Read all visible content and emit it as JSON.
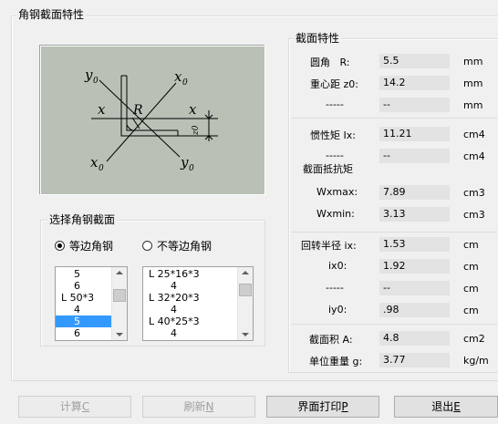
{
  "main_group": {
    "title": "角钢截面特性"
  },
  "diagram": {
    "labels": {
      "y0_top": "y",
      "x0_top": "x",
      "x_left": "x",
      "x_right": "x",
      "r": "R",
      "z0": "z0",
      "x0_bottom": "x",
      "y0_bottom": "y",
      "sub": "0"
    }
  },
  "select_group": {
    "title": "选择角钢截面",
    "equal_label": "等边角钢",
    "unequal_label": "不等边角钢",
    "equal_checked": true,
    "equal_list": [
      "5",
      "6",
      "L 50*3",
      "4",
      "5",
      "6"
    ],
    "equal_selected_index": 4,
    "unequal_list": [
      "L 25*16*3",
      "4",
      "L 32*20*3",
      "4",
      "L 40*25*3",
      "4"
    ]
  },
  "props": {
    "title": "截面特性",
    "resist_title": "截面抵抗矩",
    "rows": [
      {
        "label": "圆角   R:",
        "value": "5.5",
        "unit": "mm"
      },
      {
        "label": "重心距 z0:",
        "value": "14.2",
        "unit": "mm"
      },
      {
        "label": "-----",
        "value": "--",
        "unit": "mm"
      },
      {
        "label": "惯性矩 Ix:",
        "value": "11.21",
        "unit": "cm4"
      },
      {
        "label": "-----",
        "value": "--",
        "unit": "cm4"
      },
      {
        "label": "Wxmax:",
        "value": "7.89",
        "unit": "cm3"
      },
      {
        "label": "Wxmin:",
        "value": "3.13",
        "unit": "cm3"
      },
      {
        "label": "回转半径 ix:",
        "value": "1.53",
        "unit": "cm"
      },
      {
        "label": "ix0:",
        "value": "1.92",
        "unit": "cm"
      },
      {
        "label": "-----",
        "value": "--",
        "unit": "cm"
      },
      {
        "label": "iy0:",
        "value": ".98",
        "unit": "cm"
      },
      {
        "label": "截面积 A:",
        "value": "4.8",
        "unit": "cm2"
      },
      {
        "label": "单位重量 g:",
        "value": "3.77",
        "unit": "kg/m"
      }
    ]
  },
  "buttons": {
    "calc": {
      "text": "计算",
      "key": "C"
    },
    "refresh": {
      "text": "刷新",
      "key": "N"
    },
    "print": {
      "text": "界面打印",
      "key": "P"
    },
    "exit": {
      "text": "退出",
      "key": "E"
    }
  }
}
